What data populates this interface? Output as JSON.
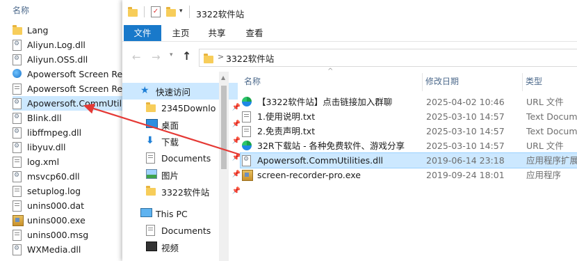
{
  "background_list": {
    "header": "名称",
    "items": [
      {
        "label": "Lang",
        "icon": "folder-icon"
      },
      {
        "label": "Aliyun.Log.dll",
        "icon": "dll-file-icon"
      },
      {
        "label": "Aliyun.OSS.dll",
        "icon": "dll-file-icon"
      },
      {
        "label": "Apowersoft Screen Reco",
        "icon": "app-icon"
      },
      {
        "label": "Apowersoft Screen Reco",
        "icon": "text-file-icon"
      },
      {
        "label": "Apowersoft.CommUtilities",
        "icon": "dll-file-icon"
      },
      {
        "label": "Blink.dll",
        "icon": "dll-file-icon"
      },
      {
        "label": "libffmpeg.dll",
        "icon": "dll-file-icon"
      },
      {
        "label": "libyuv.dll",
        "icon": "dll-file-icon"
      },
      {
        "label": "log.xml",
        "icon": "text-file-icon"
      },
      {
        "label": "msvcp60.dll",
        "icon": "dll-file-icon"
      },
      {
        "label": "setuplog.log",
        "icon": "text-file-icon"
      },
      {
        "label": "unins000.dat",
        "icon": "dat-file-icon"
      },
      {
        "label": "unins000.exe",
        "icon": "exe-icon"
      },
      {
        "label": "unins000.msg",
        "icon": "text-file-icon"
      },
      {
        "label": "WXMedia.dll",
        "icon": "dll-file-icon"
      }
    ]
  },
  "window": {
    "title": "3322软件站",
    "ribbon_tabs": [
      "文件",
      "主页",
      "共享",
      "查看"
    ],
    "address": {
      "path": "3322软件站",
      "separator": ">"
    },
    "nav": [
      {
        "label": "快速访问",
        "icon": "star-icon",
        "pinned": false
      },
      {
        "label": "2345Downlo",
        "icon": "folder-icon",
        "pinned": true
      },
      {
        "label": "桌面",
        "icon": "desktop-icon",
        "pinned": true
      },
      {
        "label": "下载",
        "icon": "download-icon",
        "pinned": true
      },
      {
        "label": "Documents",
        "icon": "documents-icon",
        "pinned": true
      },
      {
        "label": "图片",
        "icon": "pictures-icon",
        "pinned": true
      },
      {
        "label": "3322软件站",
        "icon": "folder-icon",
        "pinned": true
      },
      {
        "label": "This PC",
        "icon": "pc-icon",
        "pinned": false
      },
      {
        "label": "Documents",
        "icon": "documents-icon",
        "pinned": false
      },
      {
        "label": "视频",
        "icon": "video-icon",
        "pinned": false
      }
    ],
    "columns": {
      "name": "名称",
      "date": "修改日期",
      "type": "类型"
    },
    "files": [
      {
        "name": "【3322软件站】点击链接加入群聊",
        "date": "2025-04-02 10:46",
        "type": "URL 文件",
        "icon": "edge-url-icon"
      },
      {
        "name": "1.使用说明.txt",
        "date": "2025-03-10 14:57",
        "type": "Text Docume",
        "icon": "text-file-icon"
      },
      {
        "name": "2.免责声明.txt",
        "date": "2025-03-10 14:57",
        "type": "Text Docume",
        "icon": "text-file-icon"
      },
      {
        "name": "32R下载站 - 各种免费软件、游戏分享",
        "date": "2025-03-10 14:57",
        "type": "URL 文件",
        "icon": "edge-url-icon"
      },
      {
        "name": "Apowersoft.CommUtilities.dll",
        "date": "2019-06-14 23:18",
        "type": "应用程序扩展",
        "icon": "dll-file-icon"
      },
      {
        "name": "screen-recorder-pro.exe",
        "date": "2019-09-24 18:01",
        "type": "应用程序",
        "icon": "exe-icon"
      }
    ]
  },
  "accent": "#1979ca",
  "selection": "#cce8ff",
  "arrow_color": "#e53935"
}
